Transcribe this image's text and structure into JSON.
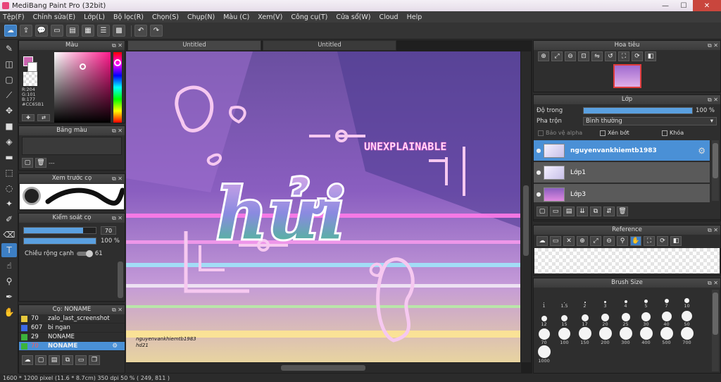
{
  "app": {
    "title": "MediBang Paint Pro (32bit)"
  },
  "window_buttons": {
    "minimize": "—",
    "maximize": "☐",
    "close": "✕"
  },
  "menu": [
    "Tệp(F)",
    "Chỉnh sửa(E)",
    "Lớp(L)",
    "Bộ lọc(R)",
    "Chọn(S)",
    "Chụp(N)",
    "Màu (C)",
    "Xem(V)",
    "Công cụ(T)",
    "Cửa sổ(W)",
    "Cloud",
    "Help"
  ],
  "tabs": [
    "Untitled",
    "Untitled"
  ],
  "color_panel": {
    "title": "Màu",
    "r": "R:204",
    "g": "G:101",
    "b": "B:177",
    "hex": "#CC65B1",
    "fg_color": "#cc65b1",
    "bg_color": "#ffffff"
  },
  "palette_panel": {
    "title": "Bảng màu",
    "value": "---"
  },
  "brush_preview": {
    "title": "Xem trước cọ"
  },
  "brush_control": {
    "title": "Kiểm soát cọ",
    "size": "70",
    "opacity": "100 %",
    "size_pct": 0.82,
    "opacity_pct": 1.0,
    "smooth_label": "Chiều rộng cạnh",
    "smooth_value": "61"
  },
  "brush_list": {
    "title": "Cọ: NONAME",
    "items": [
      {
        "size": "70",
        "name": "zalo_last_screenshot",
        "color": "#e6c83c"
      },
      {
        "size": "607",
        "name": "bi ngan",
        "color": "#3c6ae6"
      },
      {
        "size": "29",
        "name": "NONAME",
        "color": "#3cb43c"
      },
      {
        "size": "70",
        "name": "NONAME",
        "color": "#3cb43c"
      }
    ]
  },
  "canvas_art": {
    "word": "hửi",
    "sign": "UNEXPLAINABLE",
    "watermark_line1": "nguyenvankhiemtb1983",
    "watermark_line2": "hd21"
  },
  "navigator": {
    "title": "Hoa tiêu"
  },
  "layer_panel": {
    "title": "Lớp",
    "opacity_label": "Độ trong",
    "opacity_value": "100 %",
    "blend_label": "Pha trộn",
    "blend_value": "Bình thường",
    "protect_alpha": "Bảo vệ alpha",
    "clipping": "Xén bớt",
    "lock": "Khóa",
    "layers": [
      {
        "name": "nguyenvankhiemtb1983",
        "selected": true
      },
      {
        "name": "Lớp1",
        "selected": false
      },
      {
        "name": "Lớp3",
        "selected": false
      }
    ]
  },
  "reference_panel": {
    "title": "Reference"
  },
  "brush_size_panel": {
    "title": "Brush Size",
    "sizes": [
      "1",
      "1.5",
      "2",
      "3",
      "4",
      "5",
      "7",
      "10",
      "12",
      "15",
      "17",
      "20",
      "25",
      "30",
      "40",
      "50",
      "70",
      "100",
      "150",
      "200",
      "300",
      "400",
      "500",
      "700",
      "1000"
    ]
  },
  "status": {
    "text": "1600 * 1200 pixel   (11.6 * 8.7cm)   350 dpi   50 %   ( 249, 811 )"
  }
}
